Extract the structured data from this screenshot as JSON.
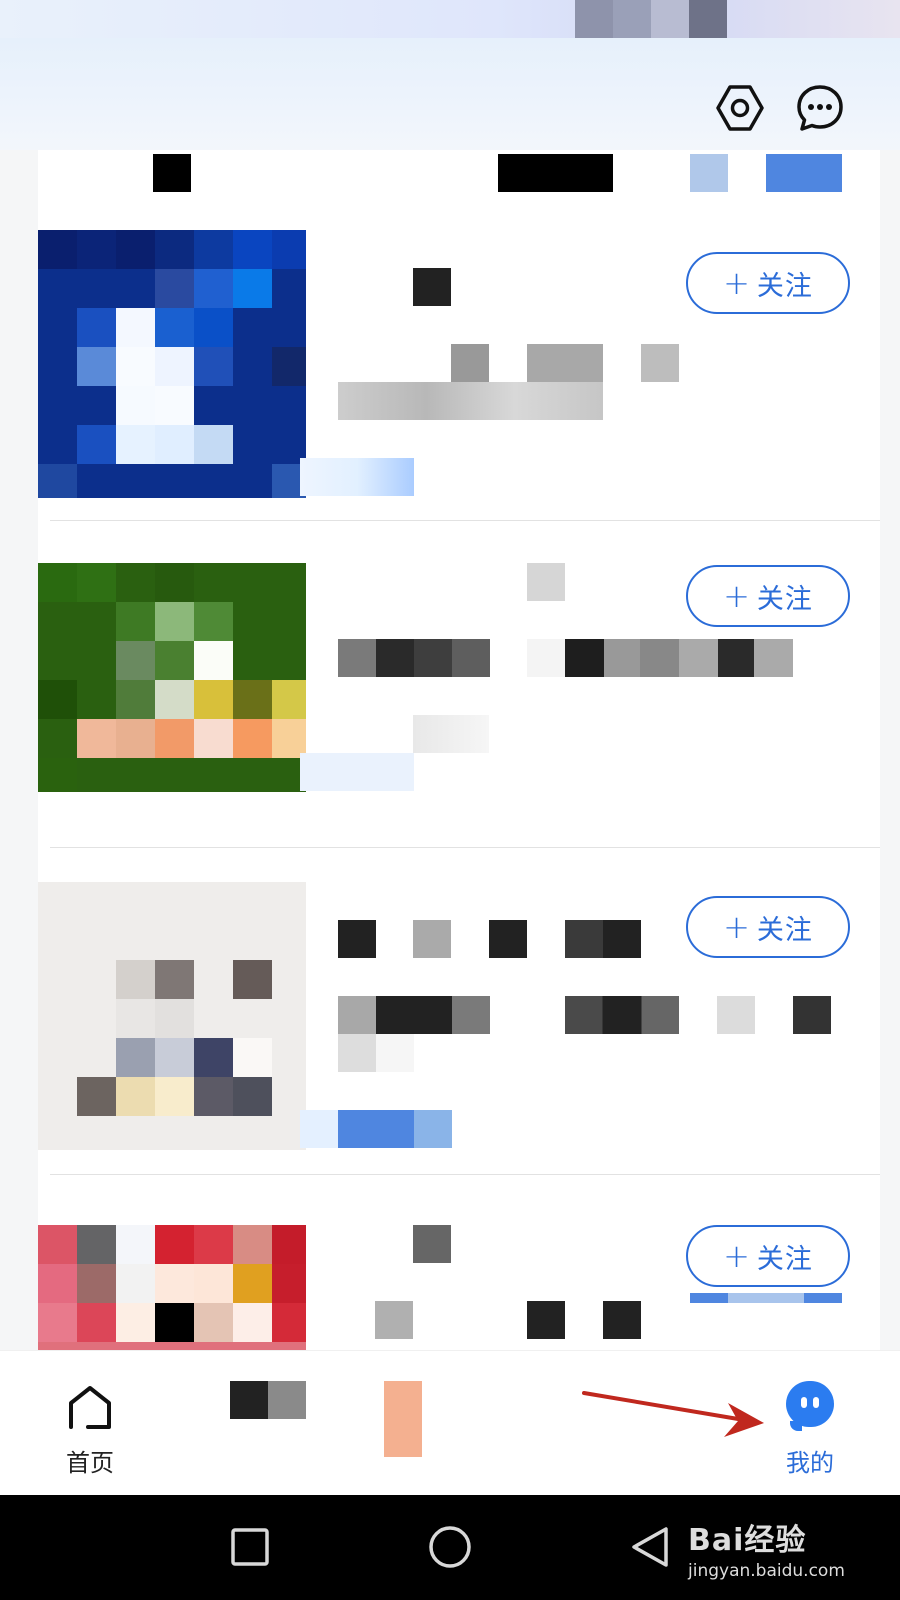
{
  "header": {
    "settings_icon": "settings-hex-icon",
    "message_icon": "message-dots-icon"
  },
  "feed": {
    "cards": [
      {
        "follow_label": "关注",
        "thumbnail": "pixelated-image"
      },
      {
        "follow_label": "关注",
        "thumbnail": "pixelated-image"
      },
      {
        "follow_label": "关注",
        "thumbnail": "pixelated-image"
      },
      {
        "follow_label": "关注",
        "thumbnail": "pixelated-image"
      }
    ]
  },
  "tabbar": {
    "home_label": "首页",
    "mine_label": "我的",
    "active_color": "#2b6cd8"
  },
  "system_nav": {
    "back_icon": "triangle-back-icon",
    "home_icon": "circle-home-icon",
    "recents_icon": "square-recents-icon"
  },
  "watermark": {
    "brand": "Bai经验",
    "url": "jingyan.baidu.com"
  },
  "colors": {
    "accent": "#2b6cd8",
    "annotation_arrow": "#c0281e"
  }
}
